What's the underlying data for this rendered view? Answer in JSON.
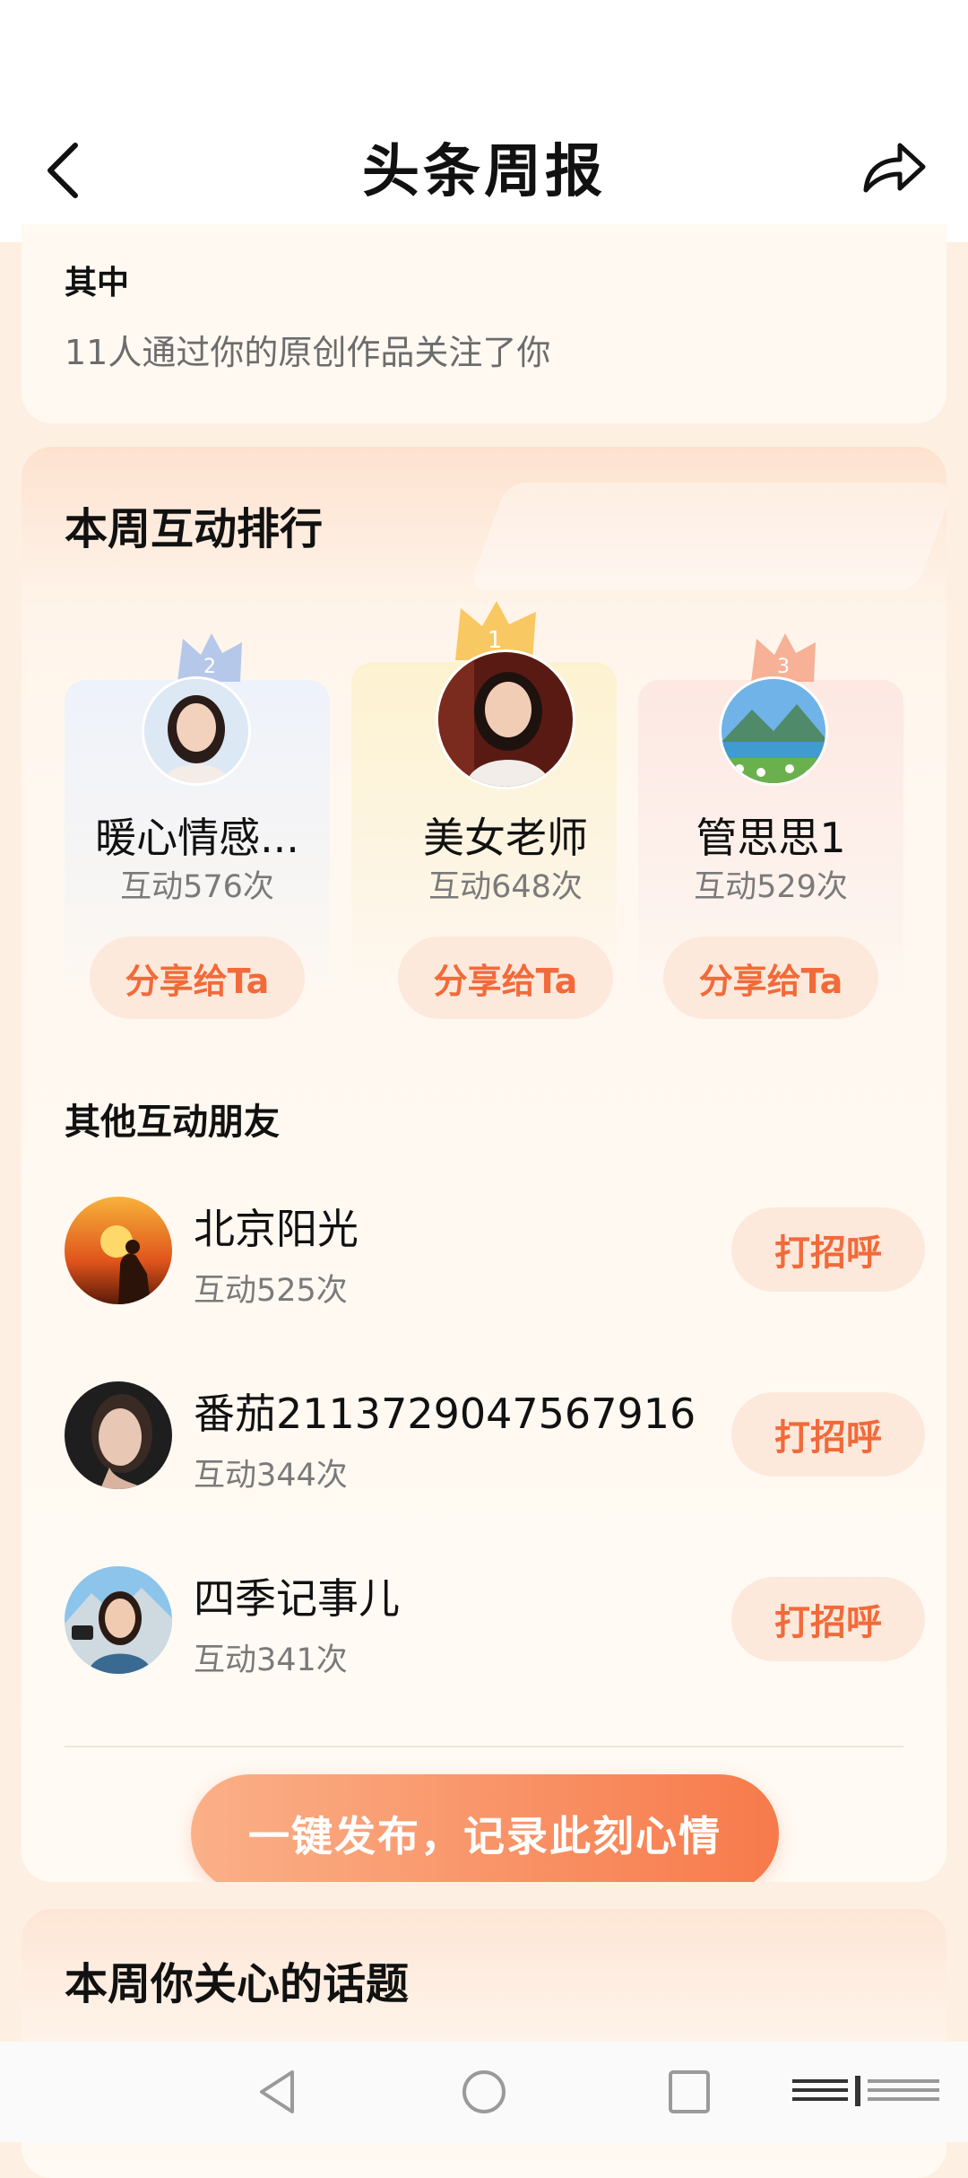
{
  "header": {
    "title": "头条周报"
  },
  "summary": {
    "heading": "其中",
    "text": "11人通过你的原创作品关注了你"
  },
  "ranking": {
    "title": "本周互动排行",
    "top": [
      {
        "rank": "2",
        "name": "暖心情感...",
        "count": "互动576次",
        "button": "分享给Ta"
      },
      {
        "rank": "1",
        "name": "美女老师",
        "count": "互动648次",
        "button": "分享给Ta"
      },
      {
        "rank": "3",
        "name": "管思思1",
        "count": "互动529次",
        "button": "分享给Ta"
      }
    ],
    "others_title": "其他互动朋友",
    "others": [
      {
        "name": "北京阳光",
        "count": "互动525次",
        "button": "打招呼"
      },
      {
        "name": "番茄2113729047567916",
        "count": "互动344次",
        "button": "打招呼"
      },
      {
        "name": "四季记事儿",
        "count": "互动341次",
        "button": "打招呼"
      }
    ],
    "publish_button": "一键发布，记录此刻心情"
  },
  "topics": {
    "title": "本周你关心的话题"
  },
  "colors": {
    "accent": "#f26a3a",
    "button_bg": "#fde9dc",
    "crown_gold": "#f7c04a",
    "crown_silver": "#9fb6e6",
    "crown_bronze": "#f4a487"
  },
  "icons": [
    "back-arrow-icon",
    "share-arrow-icon",
    "crown-icon",
    "nav-back-icon",
    "nav-home-icon",
    "nav-recents-icon",
    "nav-menu-icon"
  ]
}
